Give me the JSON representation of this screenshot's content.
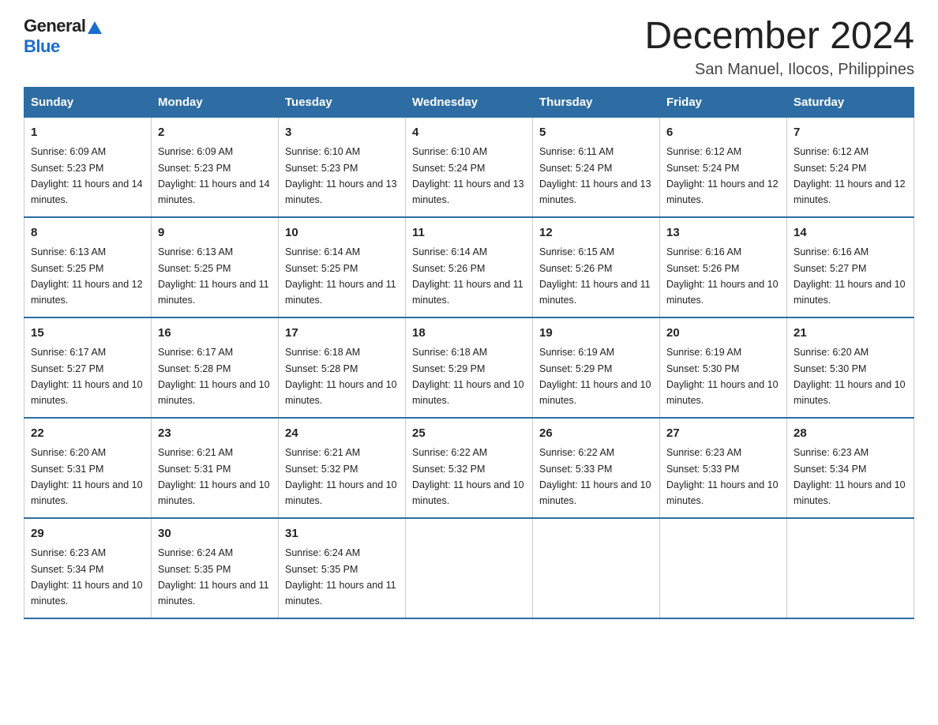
{
  "header": {
    "logo_general": "General",
    "logo_blue": "Blue",
    "month_title": "December 2024",
    "location": "San Manuel, Ilocos, Philippines"
  },
  "days_of_week": [
    "Sunday",
    "Monday",
    "Tuesday",
    "Wednesday",
    "Thursday",
    "Friday",
    "Saturday"
  ],
  "weeks": [
    [
      {
        "day": "1",
        "sunrise": "6:09 AM",
        "sunset": "5:23 PM",
        "daylight": "11 hours and 14 minutes."
      },
      {
        "day": "2",
        "sunrise": "6:09 AM",
        "sunset": "5:23 PM",
        "daylight": "11 hours and 14 minutes."
      },
      {
        "day": "3",
        "sunrise": "6:10 AM",
        "sunset": "5:23 PM",
        "daylight": "11 hours and 13 minutes."
      },
      {
        "day": "4",
        "sunrise": "6:10 AM",
        "sunset": "5:24 PM",
        "daylight": "11 hours and 13 minutes."
      },
      {
        "day": "5",
        "sunrise": "6:11 AM",
        "sunset": "5:24 PM",
        "daylight": "11 hours and 13 minutes."
      },
      {
        "day": "6",
        "sunrise": "6:12 AM",
        "sunset": "5:24 PM",
        "daylight": "11 hours and 12 minutes."
      },
      {
        "day": "7",
        "sunrise": "6:12 AM",
        "sunset": "5:24 PM",
        "daylight": "11 hours and 12 minutes."
      }
    ],
    [
      {
        "day": "8",
        "sunrise": "6:13 AM",
        "sunset": "5:25 PM",
        "daylight": "11 hours and 12 minutes."
      },
      {
        "day": "9",
        "sunrise": "6:13 AM",
        "sunset": "5:25 PM",
        "daylight": "11 hours and 11 minutes."
      },
      {
        "day": "10",
        "sunrise": "6:14 AM",
        "sunset": "5:25 PM",
        "daylight": "11 hours and 11 minutes."
      },
      {
        "day": "11",
        "sunrise": "6:14 AM",
        "sunset": "5:26 PM",
        "daylight": "11 hours and 11 minutes."
      },
      {
        "day": "12",
        "sunrise": "6:15 AM",
        "sunset": "5:26 PM",
        "daylight": "11 hours and 11 minutes."
      },
      {
        "day": "13",
        "sunrise": "6:16 AM",
        "sunset": "5:26 PM",
        "daylight": "11 hours and 10 minutes."
      },
      {
        "day": "14",
        "sunrise": "6:16 AM",
        "sunset": "5:27 PM",
        "daylight": "11 hours and 10 minutes."
      }
    ],
    [
      {
        "day": "15",
        "sunrise": "6:17 AM",
        "sunset": "5:27 PM",
        "daylight": "11 hours and 10 minutes."
      },
      {
        "day": "16",
        "sunrise": "6:17 AM",
        "sunset": "5:28 PM",
        "daylight": "11 hours and 10 minutes."
      },
      {
        "day": "17",
        "sunrise": "6:18 AM",
        "sunset": "5:28 PM",
        "daylight": "11 hours and 10 minutes."
      },
      {
        "day": "18",
        "sunrise": "6:18 AM",
        "sunset": "5:29 PM",
        "daylight": "11 hours and 10 minutes."
      },
      {
        "day": "19",
        "sunrise": "6:19 AM",
        "sunset": "5:29 PM",
        "daylight": "11 hours and 10 minutes."
      },
      {
        "day": "20",
        "sunrise": "6:19 AM",
        "sunset": "5:30 PM",
        "daylight": "11 hours and 10 minutes."
      },
      {
        "day": "21",
        "sunrise": "6:20 AM",
        "sunset": "5:30 PM",
        "daylight": "11 hours and 10 minutes."
      }
    ],
    [
      {
        "day": "22",
        "sunrise": "6:20 AM",
        "sunset": "5:31 PM",
        "daylight": "11 hours and 10 minutes."
      },
      {
        "day": "23",
        "sunrise": "6:21 AM",
        "sunset": "5:31 PM",
        "daylight": "11 hours and 10 minutes."
      },
      {
        "day": "24",
        "sunrise": "6:21 AM",
        "sunset": "5:32 PM",
        "daylight": "11 hours and 10 minutes."
      },
      {
        "day": "25",
        "sunrise": "6:22 AM",
        "sunset": "5:32 PM",
        "daylight": "11 hours and 10 minutes."
      },
      {
        "day": "26",
        "sunrise": "6:22 AM",
        "sunset": "5:33 PM",
        "daylight": "11 hours and 10 minutes."
      },
      {
        "day": "27",
        "sunrise": "6:23 AM",
        "sunset": "5:33 PM",
        "daylight": "11 hours and 10 minutes."
      },
      {
        "day": "28",
        "sunrise": "6:23 AM",
        "sunset": "5:34 PM",
        "daylight": "11 hours and 10 minutes."
      }
    ],
    [
      {
        "day": "29",
        "sunrise": "6:23 AM",
        "sunset": "5:34 PM",
        "daylight": "11 hours and 10 minutes."
      },
      {
        "day": "30",
        "sunrise": "6:24 AM",
        "sunset": "5:35 PM",
        "daylight": "11 hours and 11 minutes."
      },
      {
        "day": "31",
        "sunrise": "6:24 AM",
        "sunset": "5:35 PM",
        "daylight": "11 hours and 11 minutes."
      },
      null,
      null,
      null,
      null
    ]
  ],
  "labels": {
    "sunrise": "Sunrise:",
    "sunset": "Sunset:",
    "daylight": "Daylight:"
  }
}
